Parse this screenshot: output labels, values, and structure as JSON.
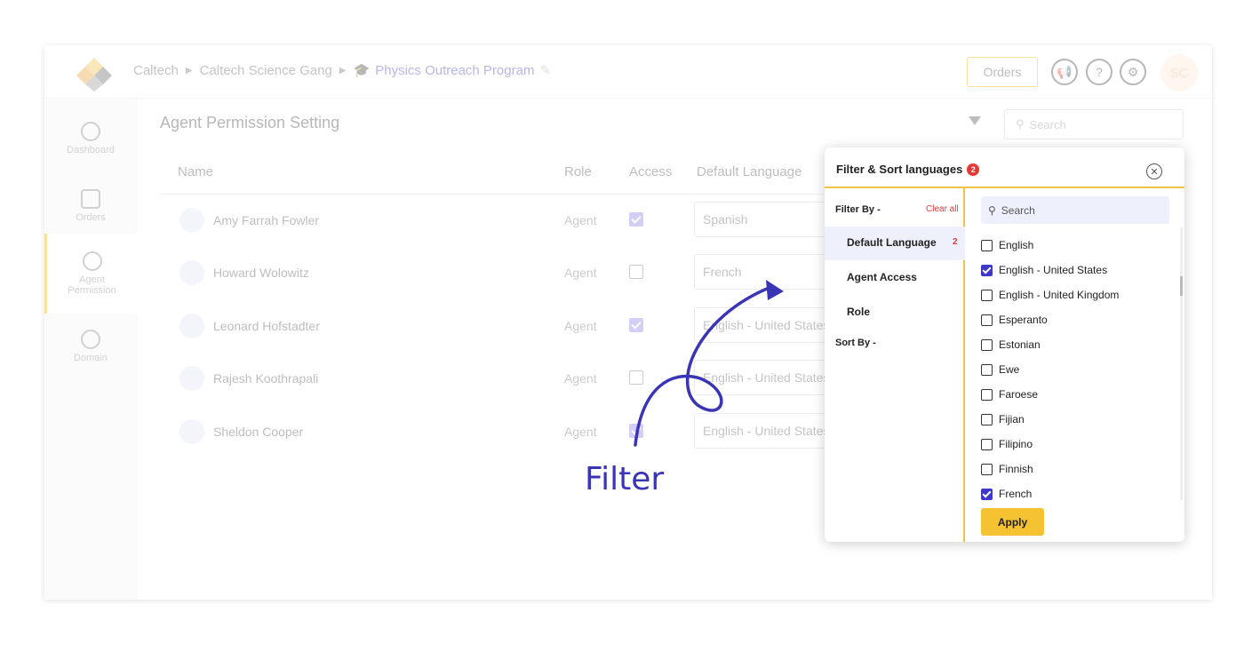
{
  "header": {
    "breadcrumbs": [
      "Caltech",
      "Caltech Science Gang",
      "Physics Outreach Program"
    ],
    "orders_label": "Orders",
    "avatar_initials": "SC"
  },
  "sidebar": {
    "items": [
      {
        "label": "Dashboard",
        "icon": "dashboard-icon"
      },
      {
        "label": "Orders",
        "icon": "box-icon"
      },
      {
        "label": "Agent Permission",
        "icon": "agent-permission-icon"
      },
      {
        "label": "Domain",
        "icon": "globe-icon"
      }
    ]
  },
  "page": {
    "title": "Agent Permission Setting",
    "search_placeholder": "Search",
    "columns": [
      "Name",
      "Role",
      "Access",
      "Default Language"
    ],
    "rows": [
      {
        "name": "Amy Farrah Fowler",
        "role": "Agent",
        "access": true,
        "language": "Spanish"
      },
      {
        "name": "Howard Wolowitz",
        "role": "Agent",
        "access": false,
        "language": "French"
      },
      {
        "name": "Leonard Hofstadter",
        "role": "Agent",
        "access": true,
        "language": "English - United States"
      },
      {
        "name": "Rajesh Koothrapali",
        "role": "Agent",
        "access": false,
        "language": "English - United States"
      },
      {
        "name": "Sheldon Cooper",
        "role": "Agent",
        "access": true,
        "language": "English - United States"
      }
    ]
  },
  "annotation": {
    "caption": "Filter",
    "color": "#3a35b5"
  },
  "popup": {
    "title": "Filter & Sort languages",
    "badge": "2",
    "filter_by": "Filter By -",
    "clear_all": "Clear all",
    "filters": [
      {
        "label": "Default Language",
        "count": "2",
        "active": true
      },
      {
        "label": "Agent Access",
        "count": "",
        "active": false
      },
      {
        "label": "Role",
        "count": "",
        "active": false
      }
    ],
    "sort_by": "Sort By -",
    "search_placeholder": "Search",
    "languages": [
      {
        "label": "English",
        "checked": false
      },
      {
        "label": "English - United States",
        "checked": true
      },
      {
        "label": "English - United Kingdom",
        "checked": false
      },
      {
        "label": "Esperanto",
        "checked": false
      },
      {
        "label": "Estonian",
        "checked": false
      },
      {
        "label": "Ewe",
        "checked": false
      },
      {
        "label": "Faroese",
        "checked": false
      },
      {
        "label": "Fijian",
        "checked": false
      },
      {
        "label": "Filipino",
        "checked": false
      },
      {
        "label": "Finnish",
        "checked": false
      },
      {
        "label": "French",
        "checked": true
      }
    ],
    "apply_label": "Apply"
  }
}
